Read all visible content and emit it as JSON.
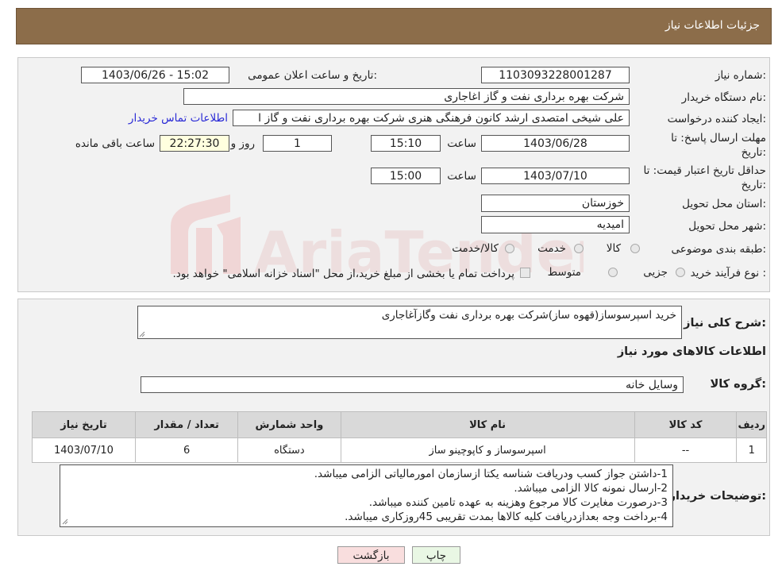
{
  "header": {
    "title": "جزئیات اطلاعات نیاز"
  },
  "form": {
    "need_number_label": "شماره نیاز:",
    "need_number": "1103093228001287",
    "announce_label": "تاریخ و ساعت اعلان عمومی:",
    "announce_value": "1403/06/26 - 15:02",
    "buyer_org_label": "نام دستگاه خریدار:",
    "buyer_org": "شرکت بهره برداری نفت و گاز اغاجاری",
    "creator_label": "ایجاد کننده درخواست:",
    "creator": "علی شیخی امتصدی ارشد کانون فرهنگی هنری شرکت بهره برداری نفت و گاز ا",
    "contact_link": "اطلاعات تماس خریدار",
    "reply_deadline_label_1": "مهلت ارسال پاسخ: تا",
    "reply_deadline_label_2": "تاریخ:",
    "reply_date": "1403/06/28",
    "time_label": "ساعت",
    "reply_time": "15:10",
    "days_value": "1",
    "days_label": "روز و",
    "remaining_time": "22:27:30",
    "remaining_label": "ساعت باقی مانده",
    "price_validity_label_1": "حداقل تاریخ اعتبار قیمت: تا",
    "price_validity_label_2": "تاریخ:",
    "price_validity_date": "1403/07/10",
    "price_validity_time_label": "ساعت",
    "price_validity_time": "15:00",
    "province_label": "استان محل تحویل:",
    "province": "خوزستان",
    "city_label": "شهر محل تحویل:",
    "city": "امیدیه",
    "category_label": "طبقه بندی موضوعی:",
    "category_options": [
      "کالا",
      "خدمت",
      "کالا/خدمت"
    ],
    "purchase_type_label": "نوع فرآیند خرید :",
    "purchase_type_options": [
      "جزیی",
      "متوسط"
    ],
    "payment_note": "پرداخت تمام یا بخشی از مبلغ خرید،از محل \"اسناد خزانه اسلامی\" خواهد بود."
  },
  "need": {
    "description_label": "شرح کلی نیاز:",
    "description": "خرید اسپرسوساز(قهوه ساز)شرکت بهره برداری نفت وگازآغاجاری",
    "goods_info_title": "اطلاعات کالاهای مورد نیاز",
    "goods_group_label": "گروه کالا:",
    "goods_group": "وسایل خانه"
  },
  "table": {
    "headers": [
      "ردیف",
      "کد کالا",
      "نام کالا",
      "واحد شمارش",
      "تعداد / مقدار",
      "تاریخ نیاز"
    ],
    "rows": [
      [
        "1",
        "--",
        "اسپرسوساز و کاپوچینو ساز",
        "دستگاه",
        "6",
        "1403/07/10"
      ]
    ]
  },
  "buyer_notes": {
    "label": "توضیحات خریدار:",
    "lines": [
      "1-داشتن جواز کسب ودریافت شناسه یکتا ازسازمان امورمالیاتی الزامی میباشد.",
      "2-ارسال نمونه کالا الزامی میباشد.",
      "3-درصورت مغایرت کالا مرجوع وهزینه به عهده تامین کننده میباشد.",
      "4-برداخت وجه بعدازدریافت کلیه کالاها بمدت تقریبی 45روزکاری میباشد."
    ]
  },
  "buttons": {
    "print": "چاپ",
    "back": "بازگشت"
  },
  "watermark": {
    "text": "AriaTender.neT"
  },
  "colors": {
    "header_bg": "#8c6d4a",
    "back_button_bg": "#f9dede",
    "print_button_bg": "#e9f7e4",
    "link": "#2a2ad6"
  }
}
